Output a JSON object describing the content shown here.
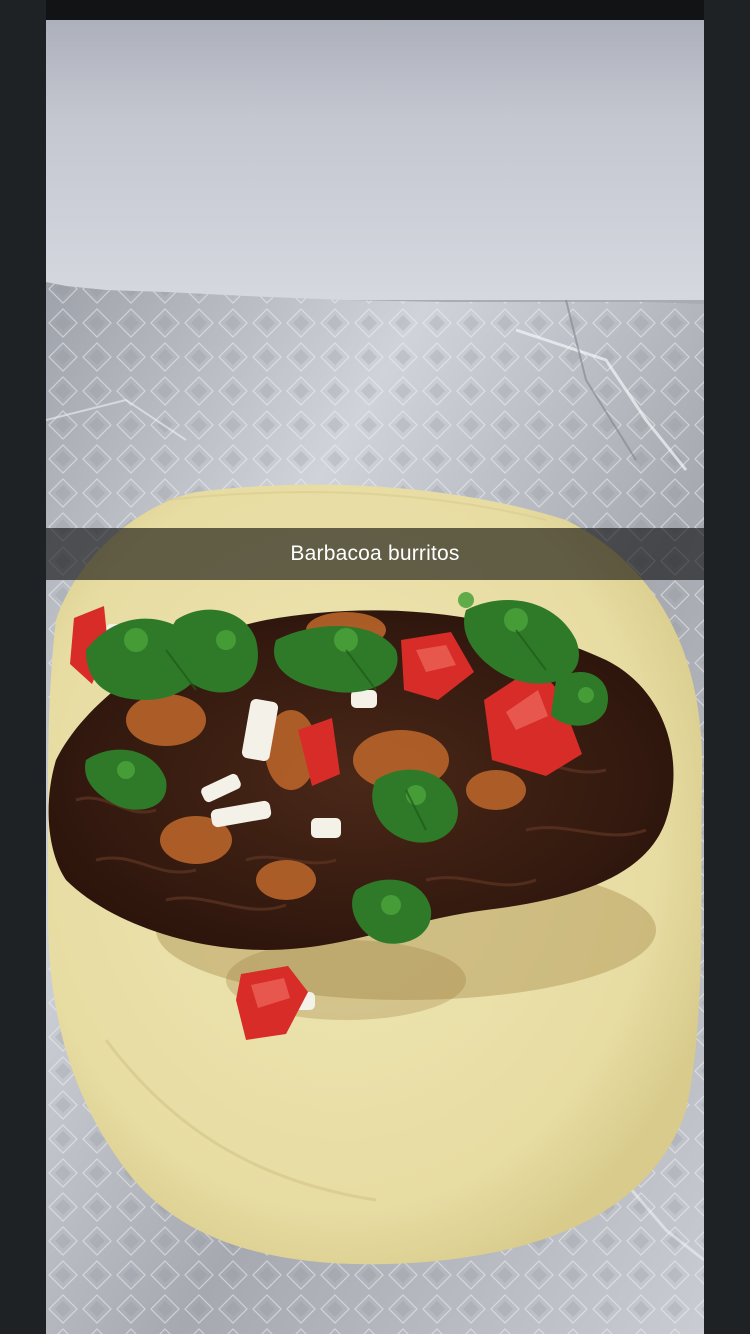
{
  "snap": {
    "caption": "Barbacoa burritos"
  },
  "photo": {
    "subject": "barbacoa-on-tortilla",
    "colors": {
      "wall": "#c7c9d2",
      "foil": "#b9bcc2",
      "tortilla": "#e9dfa8",
      "meat": "#3a1c14",
      "cilantro": "#2f7d2a",
      "tomato": "#d9302c",
      "salsa": "#b7652a",
      "onion": "#f3f1e6"
    }
  }
}
